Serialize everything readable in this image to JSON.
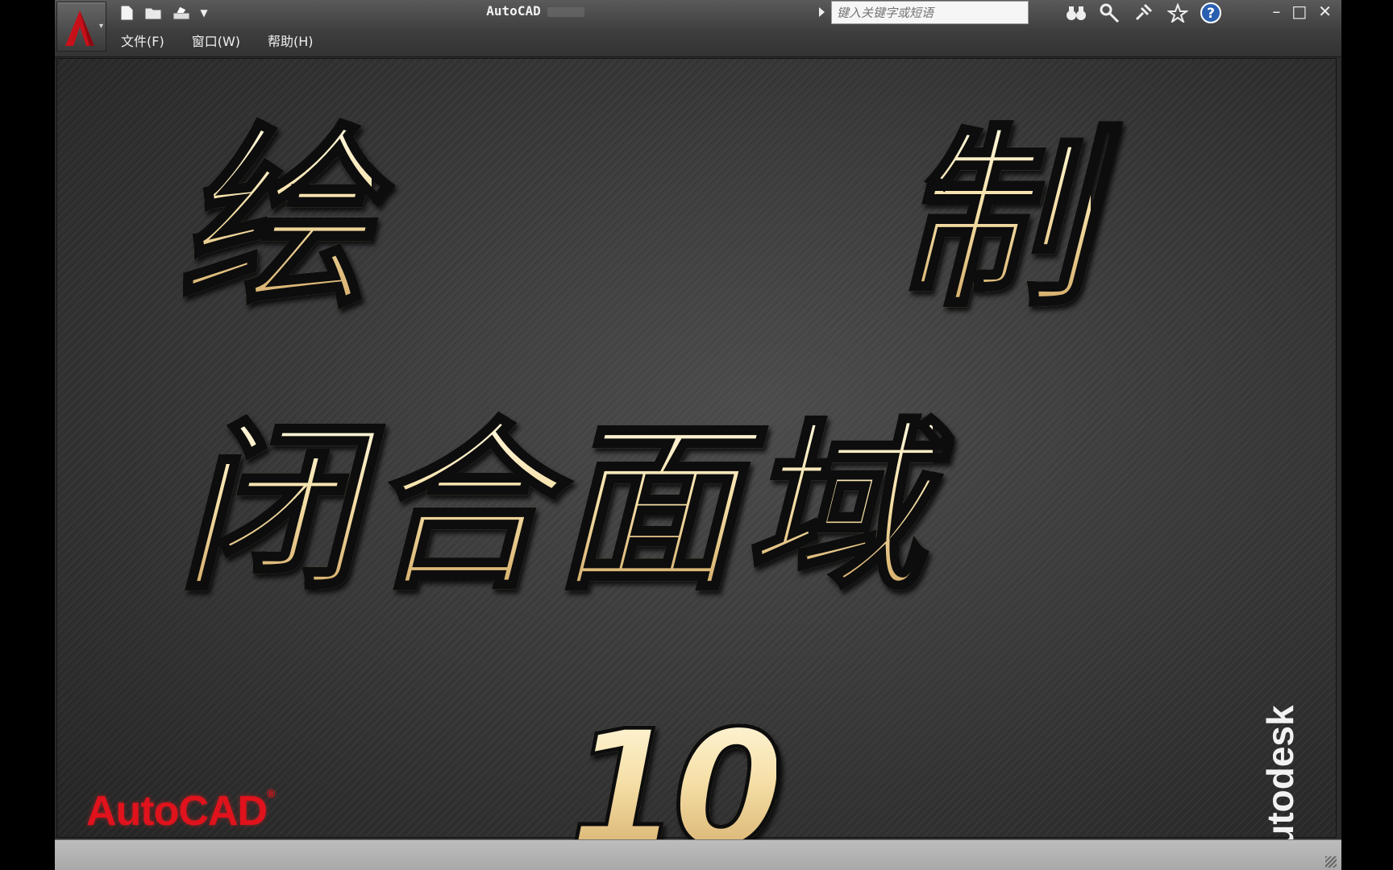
{
  "window": {
    "title": "AutoCAD"
  },
  "menus": [
    "文件(F)",
    "窗口(W)",
    "帮助(H)"
  ],
  "search": {
    "placeholder": "键入关键字或短语"
  },
  "icons": {
    "app_button": "autocad-a-icon",
    "quick_access": [
      "new-file-icon",
      "open-folder-icon",
      "plot-icon",
      "qat-dropdown-icon"
    ],
    "tools": [
      "binoculars-icon",
      "key-icon",
      "satellite-icon",
      "star-icon",
      "help-icon"
    ],
    "window_controls": [
      "minimize-icon",
      "maximize-icon",
      "close-icon"
    ]
  },
  "splash": {
    "char1": "绘",
    "char2": "制",
    "line2": "闭合面域",
    "number": "10",
    "brand_left": "AutoCAD",
    "brand_left_mark": "®",
    "brand_right": "Autodesk"
  },
  "colors": {
    "headline_gradient_top": "#fff7dc",
    "headline_gradient_bottom": "#d2a865",
    "brand_red": "#e0121c"
  }
}
